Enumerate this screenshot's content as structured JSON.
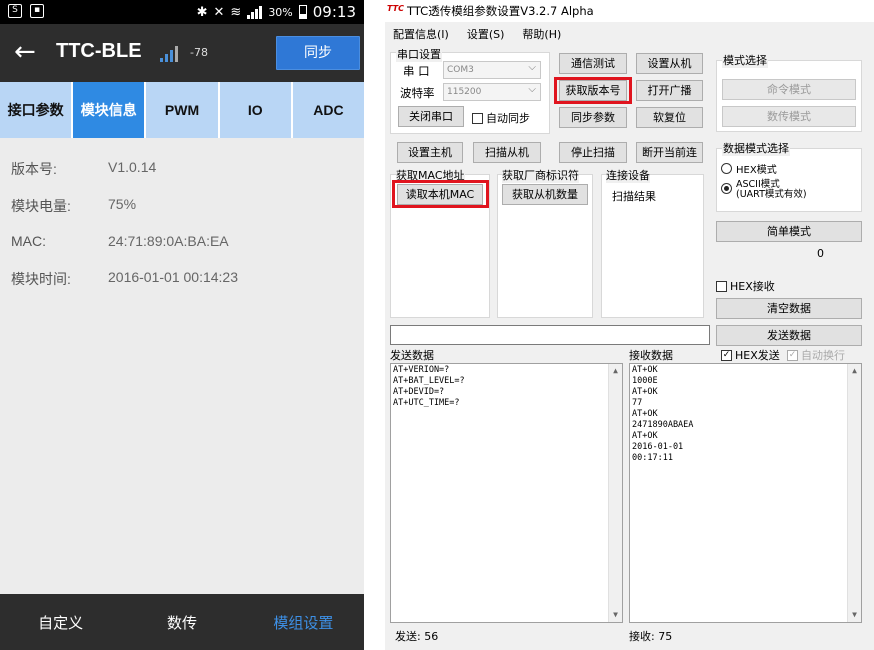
{
  "phone": {
    "status": {
      "left_icons": [
        "s-icon",
        "image-icon"
      ],
      "right_icons": [
        "bluetooth-icon",
        "mute-icon",
        "wifi-icon",
        "signal-icon"
      ],
      "battery": "30%",
      "time": "09:13"
    },
    "appbar": {
      "title": "TTC-BLE",
      "rssi": "-78",
      "sync_label": "同步"
    },
    "tabs": [
      {
        "label": "接口参数",
        "active": false
      },
      {
        "label": "模块信息",
        "active": true
      },
      {
        "label": "PWM",
        "active": false
      },
      {
        "label": "IO",
        "active": false
      },
      {
        "label": "ADC",
        "active": false
      }
    ],
    "info": [
      {
        "label": "版本号:",
        "value": "V1.0.14"
      },
      {
        "label": "模块电量:",
        "value": "75%"
      },
      {
        "label": "MAC:",
        "value": "24:71:89:0A:BA:EA"
      },
      {
        "label": "模块时间:",
        "value": "2016-01-01 00:14:23"
      }
    ],
    "bottom_nav": [
      {
        "label": "自定义",
        "active": false
      },
      {
        "label": "数传",
        "active": false
      },
      {
        "label": "模组设置",
        "active": true
      }
    ]
  },
  "desktop": {
    "title": "TTC透传模组参数设置V3.2.7 Alpha",
    "logo": "TTC",
    "menu": [
      "配置信息(I)",
      "设置(S)",
      "帮助(H)"
    ],
    "serial": {
      "group_title": "串口设置",
      "port_label": "串 口",
      "port_value": "COM3",
      "baud_label": "波特率",
      "baud_value": "115200",
      "close_button": "关闭串口",
      "auto_sync": "自动同步"
    },
    "buttons": {
      "comm_test": "通信测试",
      "set_slave": "设置从机",
      "get_version": "获取版本号",
      "open_broadcast": "打开广播",
      "sync_params": "同步参数",
      "soft_reset": "软复位",
      "set_master": "设置主机",
      "scan_slave": "扫描从机",
      "stop_scan": "停止扫描",
      "disconnect": "断开当前连",
      "read_mac": "读取本机MAC",
      "get_slave_count": "获取从机数量"
    },
    "mac_group": "获取MAC地址",
    "vendor_group": "获取厂商标识符",
    "conn_group": "连接设备",
    "scan_result": "扫描结果",
    "mode": {
      "group_title": "模式选择",
      "command": "命令模式",
      "data": "数传模式"
    },
    "data_mode": {
      "group_title": "数据模式选择",
      "hex": "HEX模式",
      "ascii_line1": "ASCII模式",
      "ascii_line2": "(UART模式有效)",
      "selected": "ascii"
    },
    "simple_mode": "简单模式",
    "counter": "0",
    "hex_recv": "HEX接收",
    "clear_data": "清空数据",
    "send_data": "发送数据",
    "send_label": "发送数据",
    "recv_label": "接收数据",
    "hex_send": "HEX发送",
    "auto_newline": "自动换行",
    "send_lines": [
      "AT+VERION=?",
      "AT+BAT_LEVEL=?",
      "AT+DEVID=?",
      "AT+UTC_TIME=?"
    ],
    "recv_lines": [
      "AT+OK",
      "1000E",
      "AT+OK",
      "77",
      "AT+OK",
      "2471890ABAEA",
      "AT+OK",
      "2016-01-01",
      "00:17:11"
    ],
    "send_count": "发送: 56",
    "recv_count": "接收: 75",
    "highlight_color": "#e0141e"
  }
}
